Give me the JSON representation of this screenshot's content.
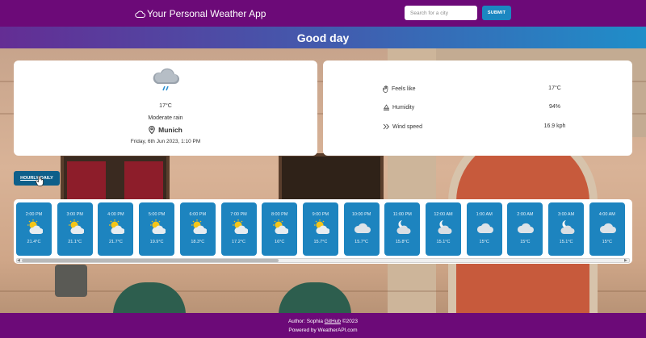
{
  "header": {
    "app_title": "Your Personal Weather App",
    "search_placeholder": "Search for a city",
    "submit_label": "SUBMIT",
    "brand_icon": "cloud-icon"
  },
  "greeting": "Good day",
  "current": {
    "icon": "rain-cloud-icon",
    "temperature": "17°C",
    "condition": "Moderate rain",
    "location": "Munich",
    "date": "Friday, 6th Jun 2023, 1:10 PM"
  },
  "details": [
    {
      "icon": "hand-icon",
      "label": "Feels like",
      "value": "17°C"
    },
    {
      "icon": "humidity-icon",
      "label": "Humidity",
      "value": "94%"
    },
    {
      "icon": "wind-icon",
      "label": "Wind speed",
      "value": "16.9 kph"
    }
  ],
  "toggle": {
    "hourly": "HOURLY",
    "daily": "DAILY",
    "active": "hourly"
  },
  "hourly": [
    {
      "time": "2:00 PM",
      "temp": "21.4°C",
      "icon": "partly-cloudy-day-icon"
    },
    {
      "time": "3:00 PM",
      "temp": "21.1°C",
      "icon": "partly-cloudy-day-icon"
    },
    {
      "time": "4:00 PM",
      "temp": "21.7°C",
      "icon": "partly-cloudy-day-icon"
    },
    {
      "time": "5:00 PM",
      "temp": "19.9°C",
      "icon": "partly-cloudy-day-icon"
    },
    {
      "time": "6:00 PM",
      "temp": "18.3°C",
      "icon": "partly-cloudy-day-icon"
    },
    {
      "time": "7:00 PM",
      "temp": "17.2°C",
      "icon": "partly-cloudy-day-icon"
    },
    {
      "time": "8:00 PM",
      "temp": "16°C",
      "icon": "partly-cloudy-day-icon"
    },
    {
      "time": "9:00 PM",
      "temp": "15.7°C",
      "icon": "partly-cloudy-day-icon"
    },
    {
      "time": "10:00 PM",
      "temp": "15.7°C",
      "icon": "cloud-icon"
    },
    {
      "time": "11:00 PM",
      "temp": "15.8°C",
      "icon": "partly-cloudy-night-icon"
    },
    {
      "time": "12:00 AM",
      "temp": "15.1°C",
      "icon": "partly-cloudy-night-icon"
    },
    {
      "time": "1:00 AM",
      "temp": "15°C",
      "icon": "cloud-icon"
    },
    {
      "time": "2:00 AM",
      "temp": "15°C",
      "icon": "cloud-icon"
    },
    {
      "time": "3:00 AM",
      "temp": "15.1°C",
      "icon": "partly-cloudy-night-icon"
    },
    {
      "time": "4:00 AM",
      "temp": "15°C",
      "icon": "cloud-icon"
    }
  ],
  "footer": {
    "author_prefix": "Author: Sophia ",
    "github_label": "GitHub",
    "author_suffix": " ©2023",
    "powered_by": "Powered by WeatherAPI.com"
  },
  "colors": {
    "nav": "#6c0a78",
    "accent": "#1d84bf",
    "submit": "#1b87c1",
    "toggle": "#0e5f8a"
  }
}
